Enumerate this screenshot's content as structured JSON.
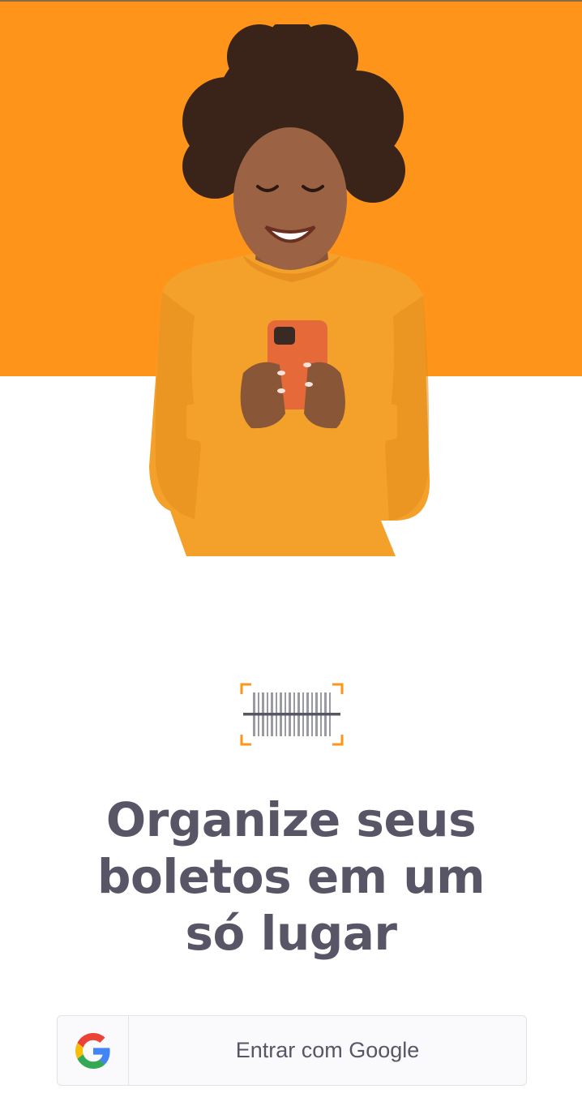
{
  "screen": {
    "background": "#FFFFFF",
    "accent_color": "#FF941A",
    "hero_image": "woman-holding-phone"
  },
  "logo": {
    "icon": "barcode-icon"
  },
  "headline": {
    "line1": "Organize seus",
    "line2": "boletos em um",
    "line3": "só lugar"
  },
  "login": {
    "icon": "google-icon",
    "label": "Entrar com Google"
  }
}
